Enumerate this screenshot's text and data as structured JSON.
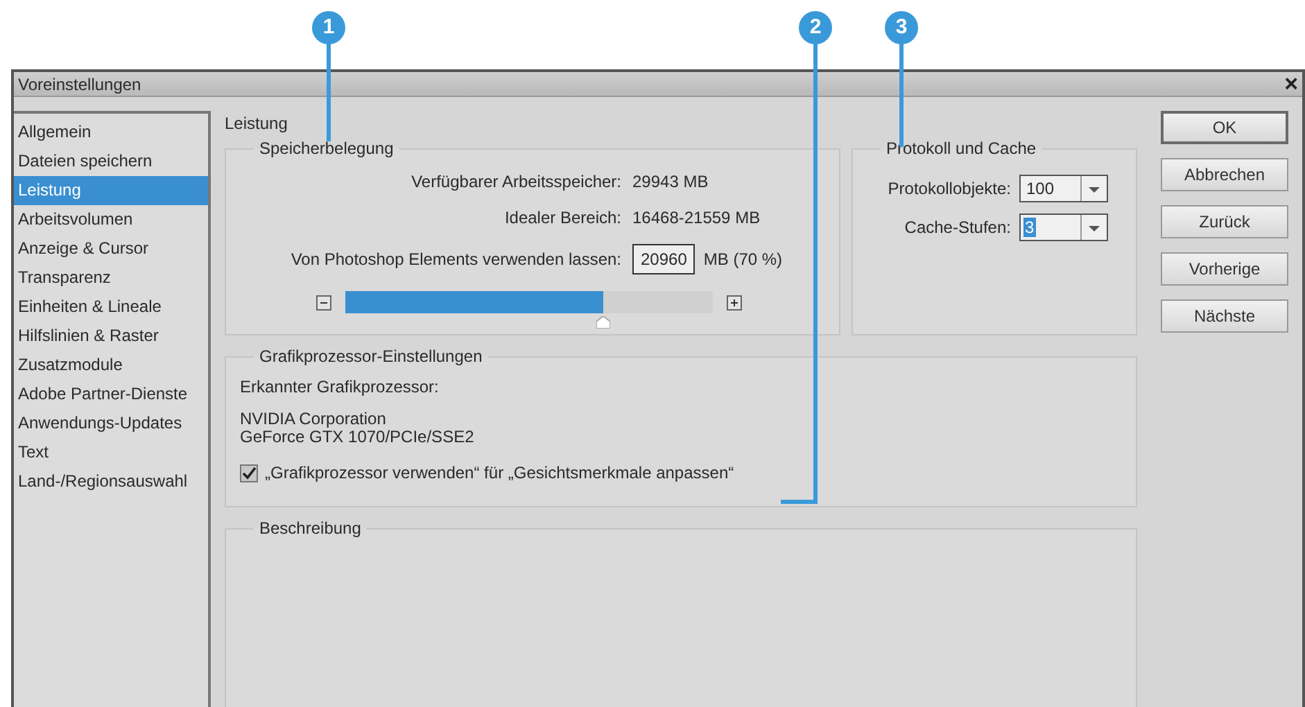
{
  "callouts": [
    {
      "label": "1"
    },
    {
      "label": "2"
    },
    {
      "label": "3"
    }
  ],
  "window": {
    "title": "Voreinstellungen",
    "close": "×"
  },
  "sidebar": {
    "items": [
      {
        "label": "Allgemein",
        "selected": false
      },
      {
        "label": "Dateien speichern",
        "selected": false
      },
      {
        "label": "Leistung",
        "selected": true
      },
      {
        "label": "Arbeitsvolumen",
        "selected": false
      },
      {
        "label": "Anzeige & Cursor",
        "selected": false
      },
      {
        "label": "Transparenz",
        "selected": false
      },
      {
        "label": "Einheiten & Lineale",
        "selected": false
      },
      {
        "label": "Hilfslinien & Raster",
        "selected": false
      },
      {
        "label": "Zusatzmodule",
        "selected": false
      },
      {
        "label": "Adobe Partner-Dienste",
        "selected": false
      },
      {
        "label": "Anwendungs-Updates",
        "selected": false
      },
      {
        "label": "Text",
        "selected": false
      },
      {
        "label": "Land-/Regionsauswahl",
        "selected": false
      }
    ]
  },
  "heading": "Leistung",
  "memory": {
    "title": "Speicherbelegung",
    "available_label": "Verfügbarer Arbeitsspeicher:",
    "available_value": "29943 MB",
    "ideal_label": "Idealer Bereich:",
    "ideal_value": "16468-21559 MB",
    "use_label": "Von Photoshop Elements verwenden lassen:",
    "use_value": "20960",
    "use_unit": "MB (70 %)",
    "level": 0.7
  },
  "history": {
    "title": "Protokoll und Cache",
    "fields": [
      {
        "label": "Protokollobjekte:",
        "value": "100",
        "highlighted": false
      },
      {
        "label": "Cache-Stufen:",
        "value": "3",
        "highlighted": true
      }
    ]
  },
  "gpu": {
    "title": "Grafikprozessor-Einstellungen",
    "detected_label": "Erkannter Grafikprozessor:",
    "lines": [
      "NVIDIA Corporation",
      "GeForce GTX 1070/PCIe/SSE2"
    ],
    "checkbox": {
      "label": "„Grafikprozessor verwenden“ für „Gesichtsmerkmale anpassen“",
      "checked": true
    }
  },
  "description": {
    "title": "Beschreibung"
  },
  "buttons": [
    {
      "label": "OK",
      "default": true
    },
    {
      "label": "Abbrechen",
      "default": false
    },
    {
      "label": "Zurück",
      "default": false
    },
    {
      "label": "Vorherige",
      "default": false
    },
    {
      "label": "Nächste",
      "default": false
    }
  ]
}
